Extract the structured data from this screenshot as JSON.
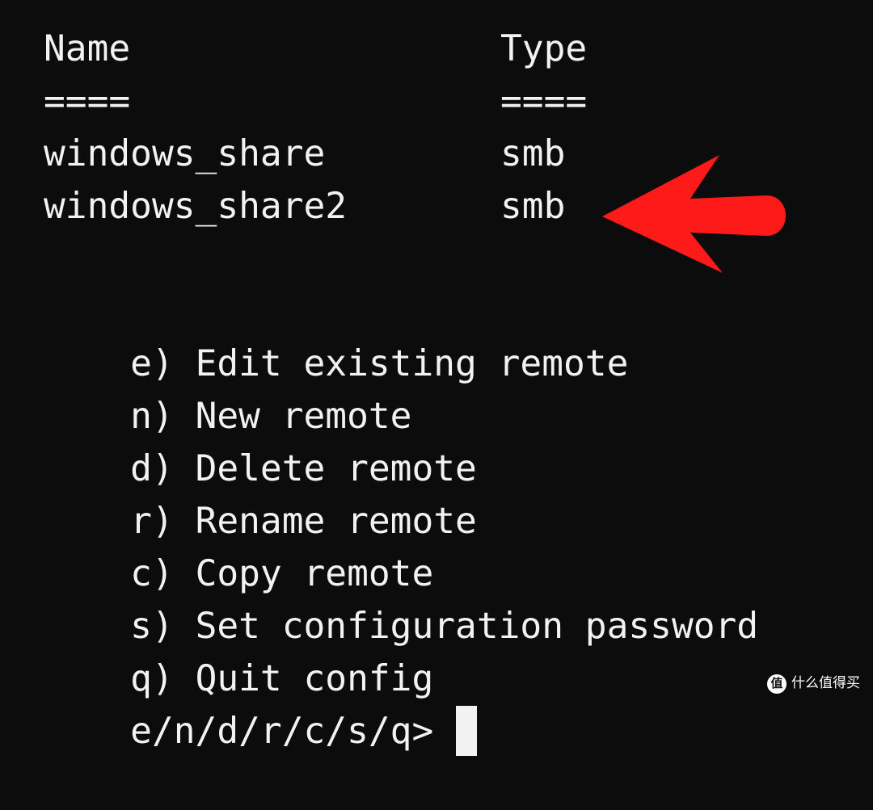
{
  "table": {
    "header": {
      "name": "Name",
      "type": "Type"
    },
    "underline": {
      "name": "====",
      "type": "===="
    },
    "rows": [
      {
        "name": "windows_share",
        "type": "smb"
      },
      {
        "name": "windows_share2",
        "type": "smb"
      }
    ]
  },
  "menu": [
    {
      "key": "e)",
      "label": "Edit existing remote"
    },
    {
      "key": "n)",
      "label": "New remote"
    },
    {
      "key": "d)",
      "label": "Delete remote"
    },
    {
      "key": "r)",
      "label": "Rename remote"
    },
    {
      "key": "c)",
      "label": "Copy remote"
    },
    {
      "key": "s)",
      "label": "Set configuration password"
    },
    {
      "key": "q)",
      "label": "Quit config"
    }
  ],
  "prompt": "e/n/d/r/c/s/q>",
  "annotation": {
    "icon": "red-arrow-left-icon",
    "color": "#ff1a1a"
  },
  "watermark": {
    "badge": "值",
    "text": "什么值得买"
  },
  "colors": {
    "background": "#0c0c0c",
    "foreground": "#f2f2f2"
  }
}
